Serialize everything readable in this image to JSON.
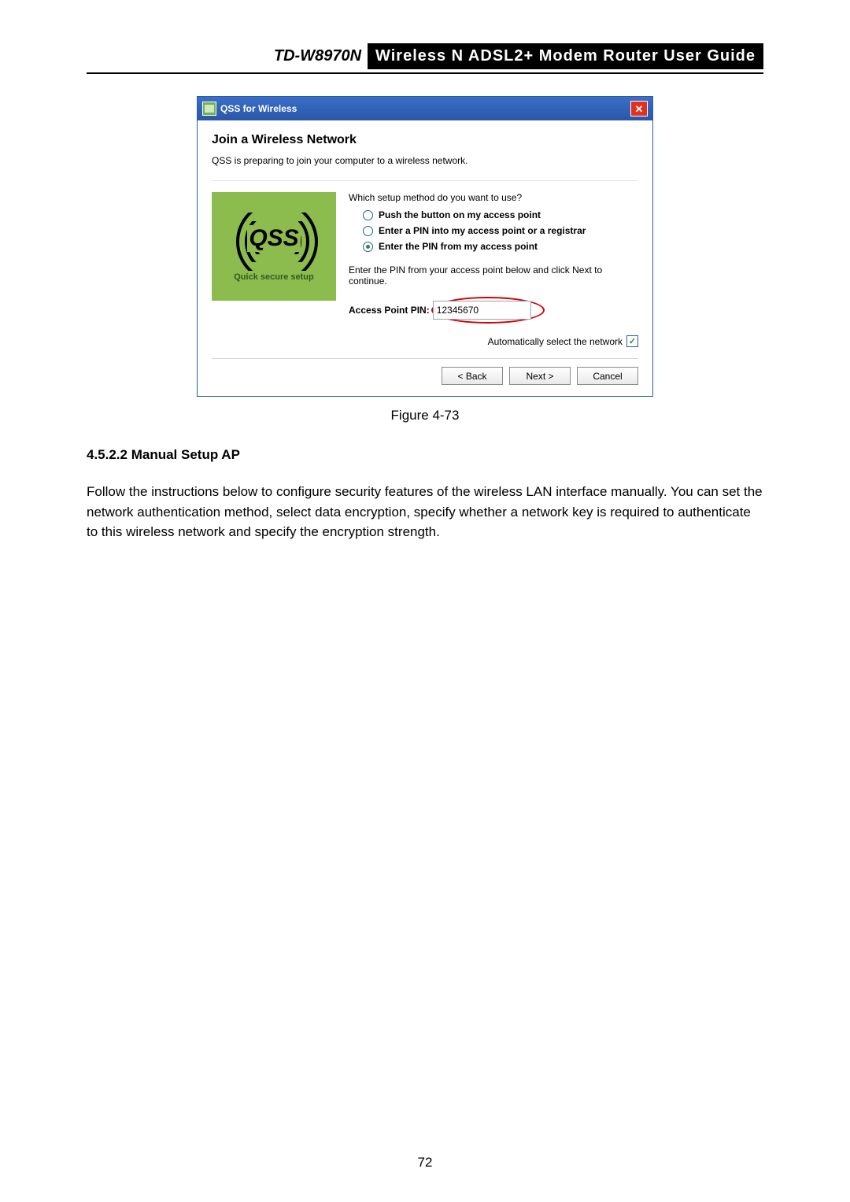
{
  "header": {
    "model": "TD-W8970N",
    "title": "Wireless  N  ADSL2+  Modem  Router  User  Guide"
  },
  "dialog": {
    "titlebar": "QSS for Wireless",
    "heading": "Join a Wireless Network",
    "subtext": "QSS is preparing to join your computer to a wireless network.",
    "qss_caption": "Quick secure setup",
    "qss_logo_text": "QSS",
    "prompt": "Which setup method do you want to use?",
    "options": [
      "Push the button on my access point",
      "Enter a PIN into my access point or a registrar",
      "Enter the PIN from my access point"
    ],
    "selected_index": 2,
    "instruction": "Enter the PIN from your access point below and click Next to continue.",
    "pin_label": "Access Point PIN:",
    "pin_value": "12345670",
    "auto_select_label": "Automatically select the network",
    "auto_select_checked": true,
    "buttons": {
      "back": "< Back",
      "next": "Next >",
      "cancel": "Cancel"
    }
  },
  "figure_caption": "Figure 4-73",
  "section": {
    "number_title": "4.5.2.2   Manual Setup AP",
    "paragraph": "Follow the instructions below to configure security features of the wireless LAN interface manually. You can set the network authentication method, select data encryption, specify whether a network key is required to authenticate to this wireless network and specify the encryption strength."
  },
  "page_number": "72"
}
